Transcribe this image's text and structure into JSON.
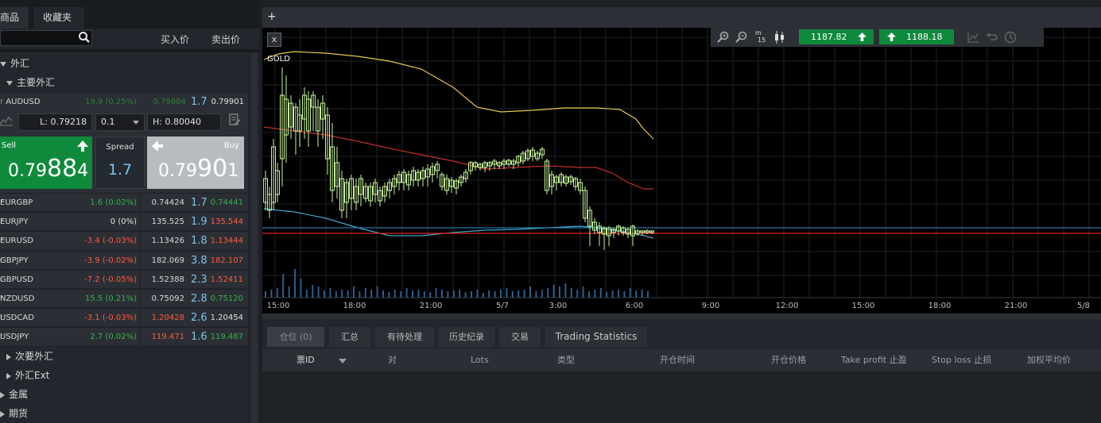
{
  "left_panel": {
    "tabs": [
      "商品",
      "收藏夹"
    ],
    "search": {
      "placeholder": ""
    },
    "col_bid": "买入价",
    "col_ask": "卖出价",
    "groups": {
      "forex": "外汇",
      "major": "主要外汇",
      "minor": "次要外汇",
      "ext": "外汇Ext",
      "metals": "金属",
      "futures": "期货"
    },
    "expanded": {
      "symbol": "AUDUSD",
      "change": "19.9 (0.25%)",
      "bid": "0.79884",
      "spread": "1.7",
      "ask": "0.79901",
      "low": "L: 0.79218",
      "qty": "0.1",
      "high": "H: 0.80040",
      "sell_label": "Sell",
      "buy_label": "Buy",
      "spread_label": "Spread",
      "sell_price_small": "0.79",
      "sell_price_big": "88",
      "sell_price_end": "4",
      "buy_price_small": "0.79",
      "buy_price_big": "90",
      "buy_price_end": "1"
    },
    "quotes": [
      {
        "symbol": "EURGBP",
        "change": "1.6 (0.02%)",
        "bid": "0.74424",
        "spread": "1.7",
        "ask": "0.74441",
        "dir": "green"
      },
      {
        "symbol": "EURJPY",
        "change": "0 (0%)",
        "bid": "135.525",
        "spread": "1.9",
        "ask": "135.544",
        "dir": "white"
      },
      {
        "symbol": "EURUSD",
        "change": "-3.4 (-0.03%)",
        "bid": "1.13426",
        "spread": "1.8",
        "ask": "1.13444",
        "dir": "red"
      },
      {
        "symbol": "GBPJPY",
        "change": "-3.9 (-0.02%)",
        "bid": "182.069",
        "spread": "3.8",
        "ask": "182.107",
        "dir": "red"
      },
      {
        "symbol": "GBPUSD",
        "change": "-7.2 (-0.05%)",
        "bid": "1.52388",
        "spread": "2.3",
        "ask": "1.52411",
        "dir": "red"
      },
      {
        "symbol": "NZDUSD",
        "change": "15.5 (0.21%)",
        "bid": "0.75092",
        "spread": "2.8",
        "ask": "0.75120",
        "dir": "green"
      },
      {
        "symbol": "USDCAD",
        "change": "-3.1 (-0.03%)",
        "bid": "1.20428",
        "spread": "2.6",
        "ask": "1.20454",
        "dir": "red"
      },
      {
        "symbol": "USDJPY",
        "change": "2.7 (0.02%)",
        "bid": "119.471",
        "spread": "1.6",
        "ask": "119.487",
        "dir": "green"
      }
    ]
  },
  "chart": {
    "add_tab": "+",
    "close_label": "x",
    "symbol": "GOLD",
    "sell_price": "1187.82",
    "buy_price": "1188.18",
    "timeframe_top": "m",
    "timeframe_bottom": "15",
    "x_ticks": [
      "15:00",
      "18:00",
      "21:00",
      "5/7",
      "3:00",
      "6:00",
      "9:00",
      "12:00",
      "15:00",
      "18:00",
      "21:00",
      "5/8"
    ],
    "colors": {
      "up": "#c8f59a",
      "bb_upper": "#e8c84a",
      "ma": "#c0302a",
      "bb_lower": "#3fa7c8",
      "hline_red": "#e02020",
      "hline_blue": "#2f8fd0"
    }
  },
  "bottom_panel": {
    "tabs": [
      "仓位 (0)",
      "汇总",
      "有待处理",
      "历史纪录",
      "交易",
      "Trading Statistics"
    ],
    "columns": [
      "票ID",
      "对",
      "Lots",
      "类型",
      "开仓时间",
      "开仓价格",
      "Take profit 止盈",
      "Stop loss 止损",
      "加权平均价"
    ]
  }
}
